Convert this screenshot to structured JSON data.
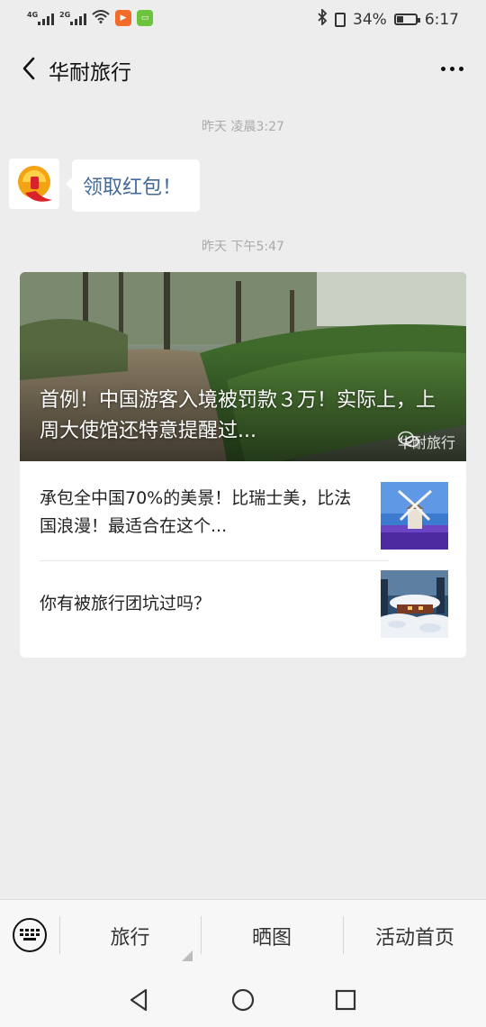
{
  "status_bar": {
    "signal1_label": "4G",
    "signal2_label": "2G",
    "battery_percent": "34%",
    "battery_level": 0.34,
    "time": "6:17",
    "icons": [
      "signal-icon",
      "signal-icon",
      "wifi-icon",
      "video-app-icon",
      "tv-app-icon",
      "bluetooth-icon",
      "vibrate-icon",
      "battery-icon"
    ]
  },
  "header": {
    "title": "华耐旅行"
  },
  "messages": [
    {
      "timestamp": "昨天 凌晨3:27",
      "bubble_text": "领取红包！"
    },
    {
      "timestamp": "昨天 下午5:47"
    }
  ],
  "article_card": {
    "hero_title": "首例！中国游客入境被罚款３万！实际上，上周大使馆还特意提醒过...",
    "hero_watermark": "华耐旅行",
    "items": [
      {
        "title": "承包全中国70%的美景！比瑞士美，比法国浪漫！最适合在这个..."
      },
      {
        "title": "你有被旅行团坑过吗？"
      }
    ]
  },
  "bottom_menu": {
    "items": [
      "旅行",
      "晒图",
      "活动首页"
    ]
  },
  "colors": {
    "background": "#ededed",
    "link_text": "#446a9a",
    "card": "#ffffff"
  }
}
